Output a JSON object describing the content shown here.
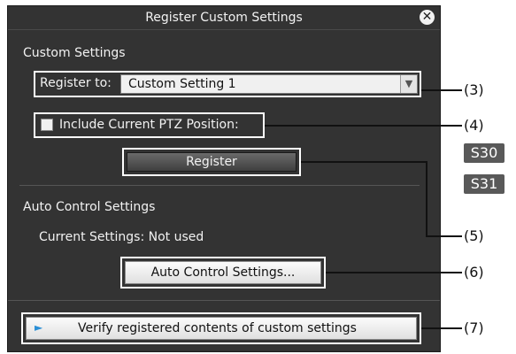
{
  "dialog": {
    "title": "Register Custom Settings",
    "close_symbol": "✕"
  },
  "custom_settings": {
    "heading": "Custom Settings",
    "register_to_label": "Register to:",
    "register_to_value": "Custom Setting 1",
    "dropdown_arrow": "▼",
    "include_ptz_label": "Include Current PTZ Position:",
    "include_ptz_checked": false,
    "register_button": "Register"
  },
  "auto_control": {
    "heading": "Auto Control Settings",
    "current_settings": "Current Settings: Not used",
    "button": "Auto Control Settings..."
  },
  "verify": {
    "play_symbol": "►",
    "button": "Verify registered contents of custom settings"
  },
  "callouts": {
    "c3": "(3)",
    "c4": "(4)",
    "c5": "(5)",
    "c6": "(6)",
    "c7": "(7)"
  },
  "badges": {
    "s30": "S30",
    "s31": "S31"
  },
  "colors": {
    "dialog_bg": "#333333",
    "highlight": "#ffffff",
    "badge_bg": "#595959",
    "play_accent": "#2a8fd6"
  }
}
